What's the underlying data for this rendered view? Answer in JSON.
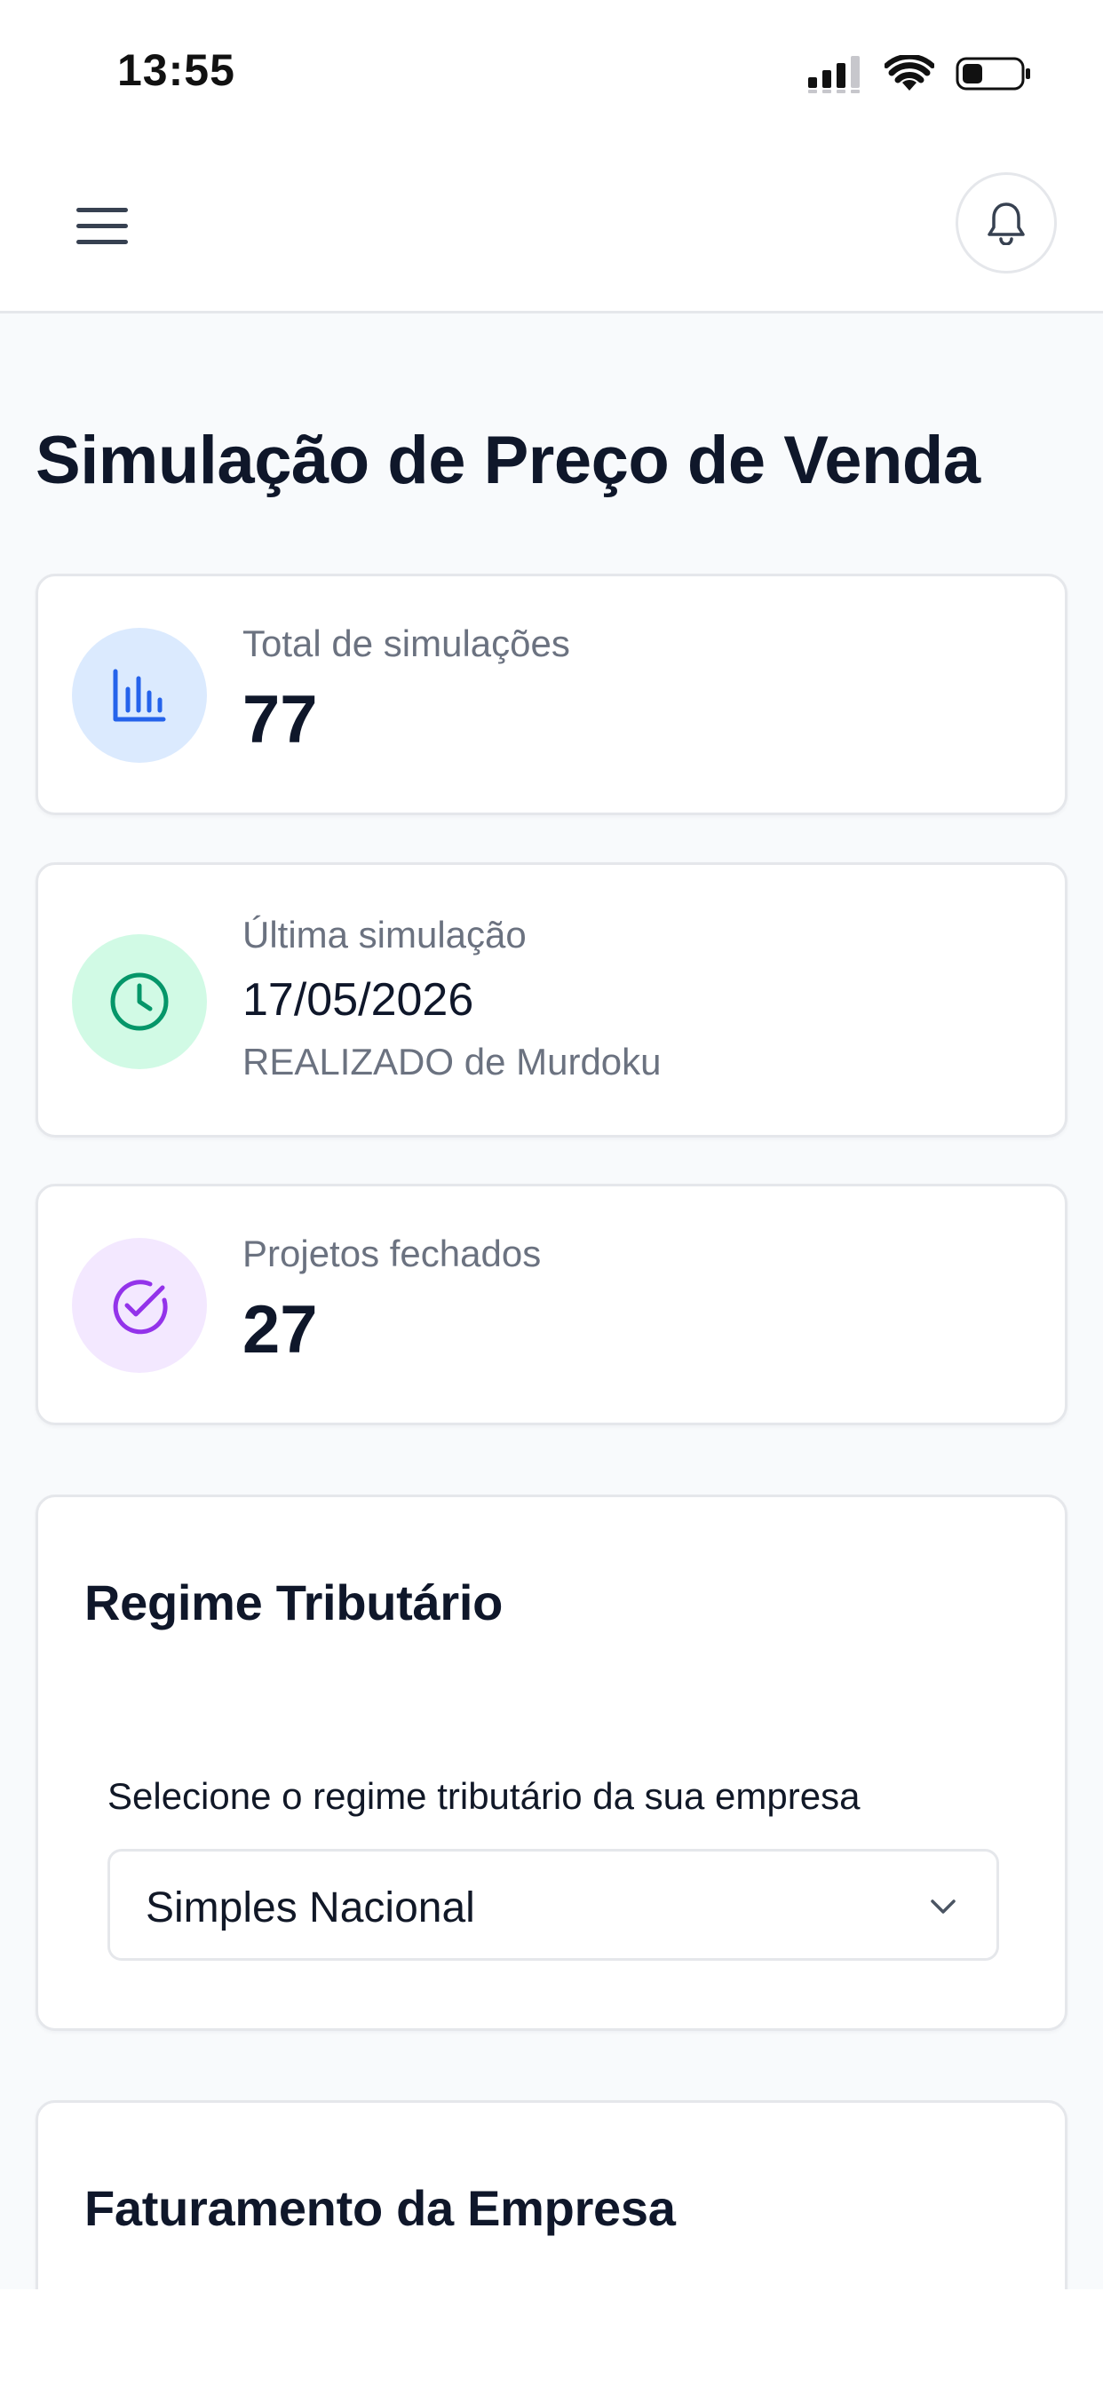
{
  "status_bar": {
    "time": "13:55"
  },
  "header": {
    "menu_icon": "hamburger-menu-icon",
    "bell_icon": "bell-icon"
  },
  "page": {
    "title": "Simulação de Preço de Venda"
  },
  "stats": {
    "total": {
      "label": "Total de simulações",
      "value": "77",
      "icon": "bar-chart-icon",
      "icon_color": "#2563eb",
      "bg_color": "#dbeafe"
    },
    "last": {
      "label": "Última simulação",
      "date": "17/05/2026",
      "subtitle": "REALIZADO de Murdoku",
      "icon": "clock-icon",
      "icon_color": "#059669",
      "bg_color": "#d1fae5"
    },
    "closed": {
      "label": "Projetos fechados",
      "value": "27",
      "icon": "check-circle-icon",
      "icon_color": "#9333ea",
      "bg_color": "#f3e8ff"
    }
  },
  "regime": {
    "title": "Regime Tributário",
    "field_label": "Selecione o regime tributário da sua empresa",
    "selected": "Simples Nacional"
  },
  "faturamento": {
    "title": "Faturamento da Empresa"
  }
}
